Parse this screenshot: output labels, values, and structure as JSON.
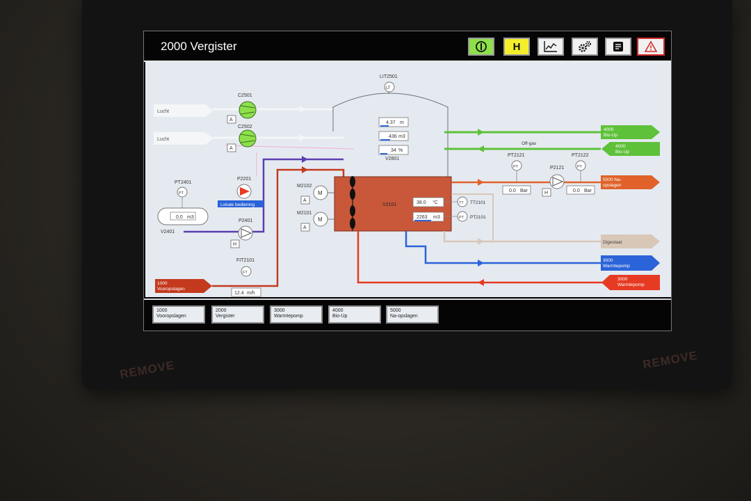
{
  "bezel": {
    "mark_left": "REMOVE",
    "mark_right": "REMOVE"
  },
  "header": {
    "title": "2000 Vergister",
    "buttons": {
      "start_icon": "power-icon",
      "hand_label": "H",
      "trend_icon": "trend-chart-icon",
      "settings_icon": "gears-icon",
      "report_icon": "document-icon",
      "alarm_icon": "warning-icon"
    }
  },
  "inputs": {
    "air1": "Lucht",
    "air2": "Lucht",
    "feed": {
      "line1": "1000",
      "line2": "Vooropslagen"
    }
  },
  "outputs": {
    "bioup1": {
      "line1": "4000",
      "line2": "Bio-Up"
    },
    "bioup2": {
      "line1": "4000",
      "line2": "Bio-Up"
    },
    "offgas": "Off-gas",
    "naopslagen": {
      "line1": "5000 Na-",
      "line2": "opslagen"
    },
    "digestaat": "Digestaat",
    "warmtepomp_out": {
      "line1": "3000",
      "line2": "Warmtepomp"
    },
    "warmtepomp_in": {
      "line1": "3000",
      "line2": "Warmtepomp"
    }
  },
  "equipment": {
    "C2501": {
      "tag": "C2501",
      "mode": "A"
    },
    "C2502": {
      "tag": "C2502",
      "mode": "A"
    },
    "P2201": {
      "tag": "P2201",
      "local_label": "Lokale bediening"
    },
    "PT2401": {
      "tag": "PT2401",
      "symbol": "PT"
    },
    "V2401": {
      "tag": "V2401",
      "value": "0.0",
      "unit": "m3"
    },
    "P2401": {
      "tag": "P2401",
      "mode": "H"
    },
    "FIT2101": {
      "tag": "FIT2101",
      "symbol": "FT",
      "value": "12.4",
      "unit": "m/h"
    },
    "LIT2501": {
      "tag": "LIT2501",
      "symbol": "LT",
      "level": "4.37",
      "level_unit": "m",
      "volume": "436",
      "volume_unit": "m3",
      "percent": "34",
      "percent_unit": "%"
    },
    "V2801": {
      "tag": "V2801"
    },
    "M2102": {
      "tag": "M2102",
      "symbol": "M",
      "mode": "A"
    },
    "M2101": {
      "tag": "M2101",
      "symbol": "M",
      "mode": "A"
    },
    "V2101": {
      "tag": "V2101",
      "temp": "38.0",
      "temp_unit": "°C",
      "volume": "2263",
      "volume_unit": "m3"
    },
    "TT2101": {
      "tag": "TT2101",
      "symbol": "TT"
    },
    "PT2101": {
      "tag": "PT2101",
      "symbol": "PT"
    },
    "PT2121": {
      "tag": "PT2121",
      "symbol": "PT",
      "value": "0.0",
      "unit": "Bar"
    },
    "P2121": {
      "tag": "P2121",
      "mode": "H"
    },
    "PT2122": {
      "tag": "PT2122",
      "symbol": "PT",
      "value": "0.0",
      "unit": "Bar"
    }
  },
  "nav": [
    {
      "line1": "1000",
      "line2": "Vooropslagen"
    },
    {
      "line1": "2000",
      "line2": "Vergister"
    },
    {
      "line1": "3000",
      "line2": "Warmtepomp"
    },
    {
      "line1": "4000",
      "line2": "Bio-Up"
    },
    {
      "line1": "5000",
      "line2": "Na-opslagen"
    }
  ],
  "colors": {
    "air": "#f4f6f8",
    "gas_green": "#5ec13a",
    "digestate_orange": "#e0622a",
    "feed_red": "#c33a1e",
    "heat_blue": "#2b63d8",
    "heat_red": "#e63a22",
    "purple": "#5a3fb0",
    "digester": "#c9583a",
    "digestaat_line": "#d9c7b8"
  }
}
